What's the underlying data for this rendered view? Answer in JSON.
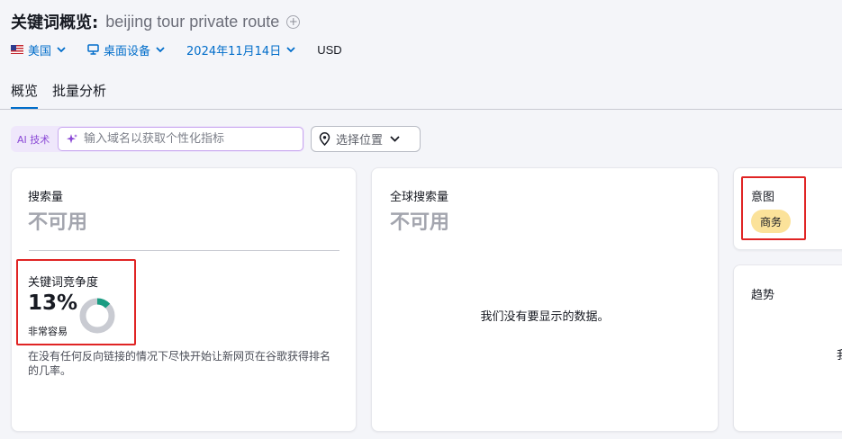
{
  "header": {
    "title": "关键词概览:",
    "keyword": "beijing tour private route"
  },
  "filters": {
    "country": "美国",
    "device": "桌面设备",
    "date": "2024年11月14日",
    "currency": "USD"
  },
  "tabs": [
    {
      "label": "概览",
      "active": true
    },
    {
      "label": "批量分析",
      "active": false
    }
  ],
  "ai": {
    "label": "AI 技术",
    "placeholder": "输入域名以获取个性化指标"
  },
  "location": {
    "label": "选择位置"
  },
  "cards": {
    "volume": {
      "label": "搜索量",
      "value": "不可用"
    },
    "global_volume": {
      "label": "全球搜索量",
      "value": "不可用",
      "empty_message": "我们没有要显示的数据。"
    },
    "kd": {
      "label": "关键词竞争度",
      "percent": "13%",
      "level": "非常容易",
      "fraction": 0.13,
      "description": "在没有任何反向链接的情况下尽快开始让新网页在谷歌获得排名的几率。"
    },
    "intent": {
      "label": "意图",
      "badge": "商务"
    },
    "trend": {
      "label": "趋势",
      "cut_text": "我"
    }
  },
  "colors": {
    "accent": "#006dca",
    "kd_fill": "#1a9c82",
    "kd_track": "#c9cbd2",
    "intent_badge": "#fbe29a",
    "highlight_box": "#e02424",
    "ai_purple": "#8a48d6"
  }
}
